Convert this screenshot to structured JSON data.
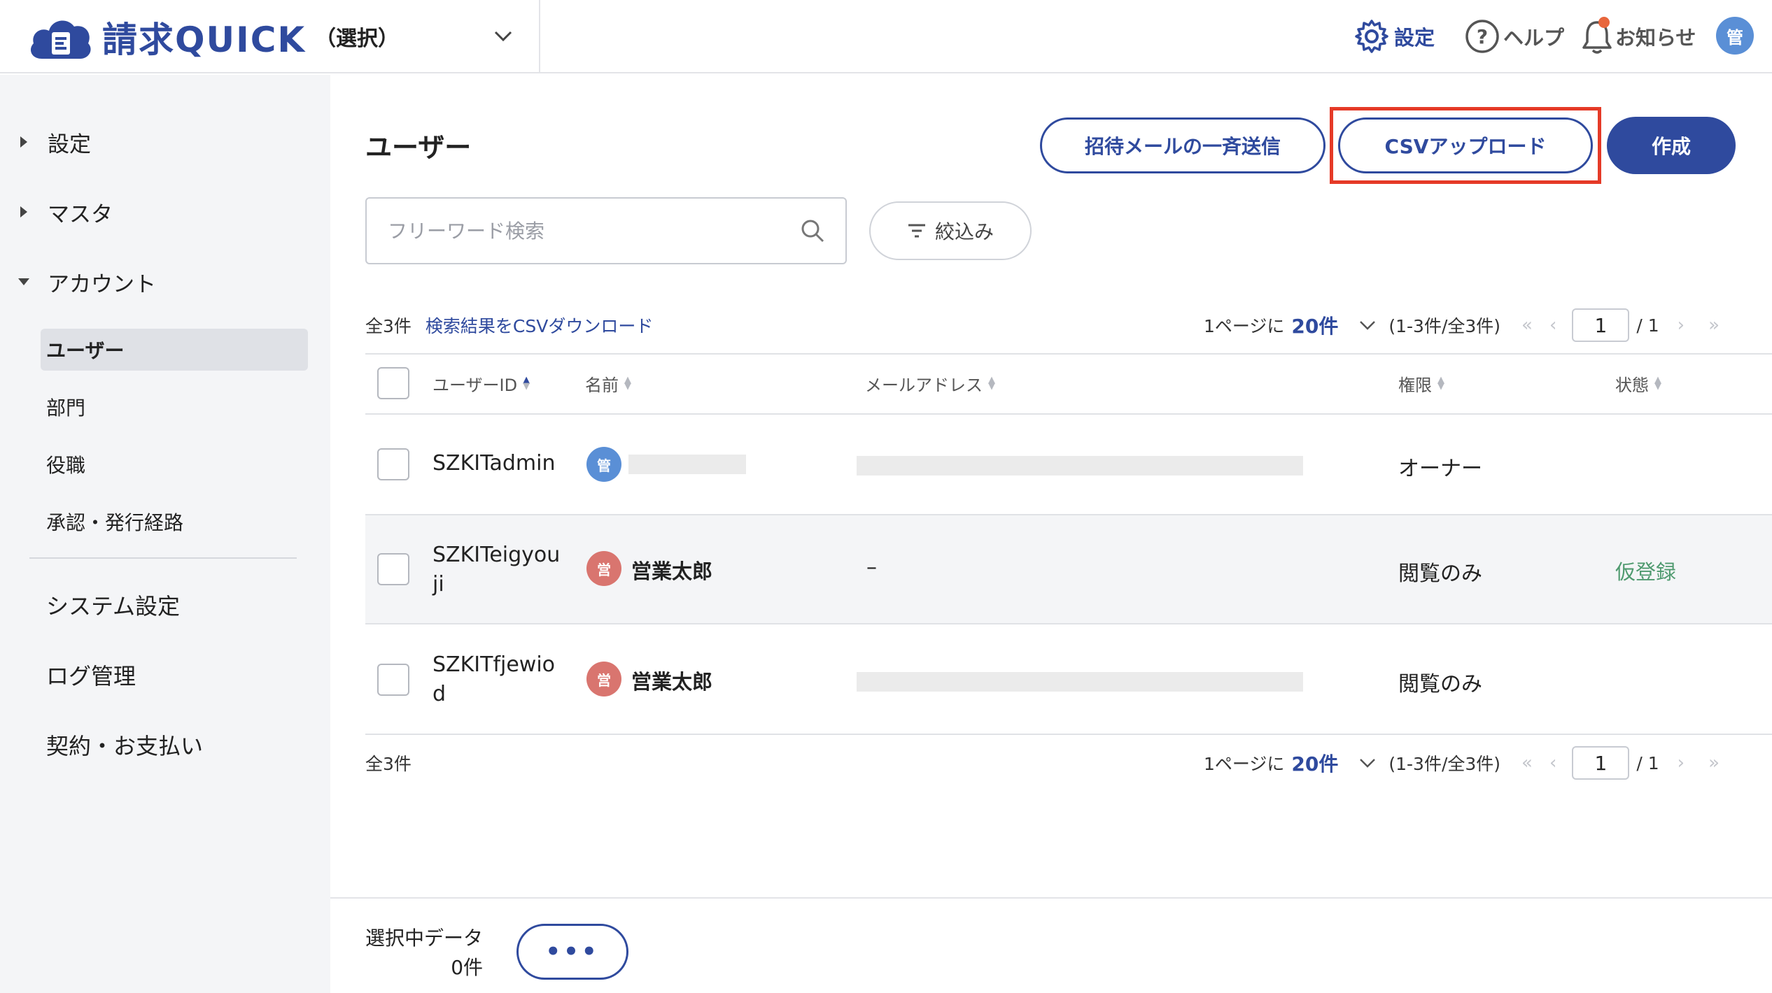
{
  "header": {
    "app_name": "請求QUICK",
    "company_select": "（選択）",
    "settings": "設定",
    "help": "ヘルプ",
    "notifications": "お知らせ",
    "avatar": "管"
  },
  "sidebar": {
    "groups": [
      {
        "label": "設定",
        "expanded": false
      },
      {
        "label": "マスタ",
        "expanded": false
      },
      {
        "label": "アカウント",
        "expanded": true
      }
    ],
    "account_items": [
      {
        "label": "ユーザー",
        "active": true
      },
      {
        "label": "部門",
        "active": false
      },
      {
        "label": "役職",
        "active": false
      },
      {
        "label": "承認・発行経路",
        "active": false
      }
    ],
    "bottom_items": [
      "システム設定",
      "ログ管理",
      "契約・お支払い"
    ]
  },
  "main": {
    "title": "ユーザー",
    "buttons": {
      "bulk_invite": "招待メールの一斉送信",
      "csv_upload": "CSVアップロード",
      "create": "作成"
    },
    "search": {
      "placeholder": "フリーワード検索",
      "value": ""
    },
    "filter": "絞込み",
    "total": "全3件",
    "csv_download": "検索結果をCSVダウンロード",
    "pager": {
      "per_page_prefix": "1ページに",
      "per_page_value": "20件",
      "range": "(1-3件/全3件)",
      "current_page": "1",
      "total_pages": "/ 1"
    },
    "columns": {
      "user_id": "ユーザーID",
      "name": "名前",
      "email": "メールアドレス",
      "role": "権限",
      "status": "状態"
    },
    "rows": [
      {
        "user_id": "SZKITadmin",
        "avatar": "管",
        "avatar_color": "#5a8fd6",
        "name": "",
        "email": "",
        "role": "オーナー",
        "status": ""
      },
      {
        "user_id": "SZKITeigyouji",
        "avatar": "営",
        "avatar_color": "#d9756f",
        "name": "営業太郎",
        "email": "–",
        "role": "閲覧のみ",
        "status": "仮登録"
      },
      {
        "user_id": "SZKITfjewiod",
        "avatar": "営",
        "avatar_color": "#d9756f",
        "name": "営業太郎",
        "email": "",
        "role": "閲覧のみ",
        "status": ""
      }
    ]
  },
  "footer": {
    "selected_label": "選択中データ",
    "selected_count": "0件",
    "more": "•••"
  },
  "colors": {
    "brand": "#2f4a9e",
    "highlight": "#e53a27",
    "status_pending": "#4f9a6f"
  }
}
